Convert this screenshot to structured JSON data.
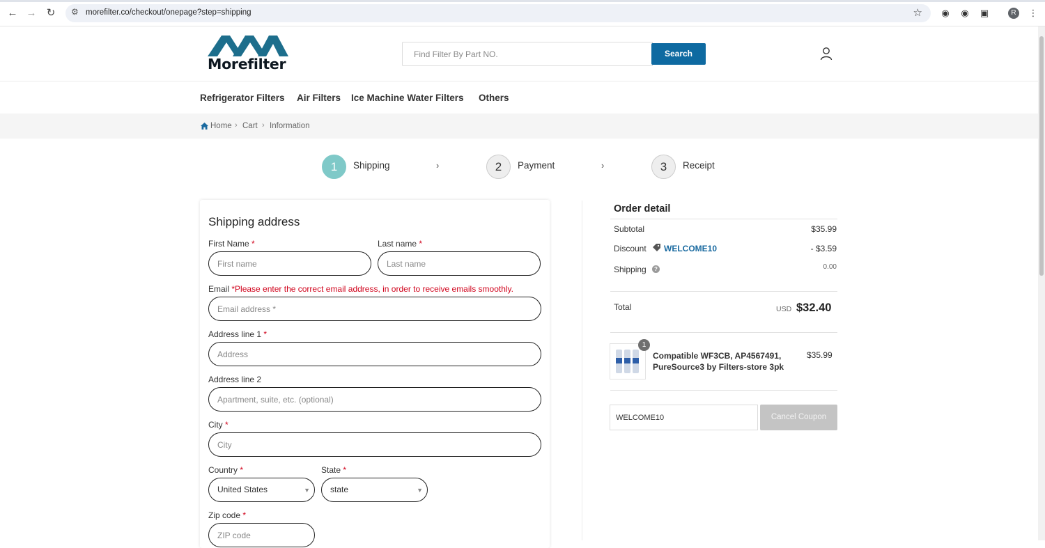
{
  "browser": {
    "url": "morefilter.co/checkout/onepage?step=shipping",
    "profile_initial": "R",
    "icons": [
      "back-icon",
      "forward-icon",
      "reload-icon",
      "site-settings-icon",
      "bookmark-star-icon",
      "extension-icon",
      "puzzle-icon",
      "menu-dots-icon"
    ]
  },
  "header": {
    "logo_text": "Morefilter",
    "search_placeholder": "Find Filter By Part NO.",
    "search_button": "Search"
  },
  "menu": [
    "Refrigerator Filters",
    "Air Filters",
    "Ice Machine Water Filters",
    "Others"
  ],
  "breadcrumb": [
    "Home",
    "Cart",
    "Information"
  ],
  "steps": [
    {
      "num": "1",
      "label": "Shipping"
    },
    {
      "num": "2",
      "label": "Payment"
    },
    {
      "num": "3",
      "label": "Receipt"
    }
  ],
  "shipping": {
    "title": "Shipping address",
    "first_name_label": "First Name",
    "first_name_placeholder": "First name",
    "last_name_label": "Last name",
    "last_name_placeholder": "Last name",
    "email_label": "Email",
    "email_warning": "*Please enter the correct email address, in order to receive emails smoothly.",
    "email_placeholder": "Email address *",
    "address1_label": "Address line 1",
    "address1_placeholder": "Address",
    "address2_label": "Address line 2",
    "address2_placeholder": "Apartment, suite, etc. (optional)",
    "city_label": "City",
    "city_placeholder": "City",
    "country_label": "Country",
    "country_value": "United States",
    "state_label": "State",
    "state_value": "state",
    "zip_label": "Zip code",
    "zip_placeholder": "ZIP code",
    "required_mark": "*"
  },
  "order": {
    "title": "Order detail",
    "subtotal_label": "Subtotal",
    "subtotal": "$35.99",
    "discount_label": "Discount",
    "coupon_code": "WELCOME10",
    "discount": "- $3.59",
    "shipping_label": "Shipping",
    "shipping": "0.00",
    "total_label": "Total",
    "currency": "USD",
    "total": "$32.40",
    "item": {
      "qty": "1",
      "name": "Compatible WF3CB, AP4567491, PureSource3 by Filters-store 3pk",
      "price": "$35.99"
    },
    "coupon_input_value": "WELCOME10",
    "cancel_coupon": "Cancel Coupon"
  },
  "colors": {
    "brand_blue": "#0e6aa1",
    "step_active": "#7fc9c8",
    "required_red": "#d0021b"
  }
}
